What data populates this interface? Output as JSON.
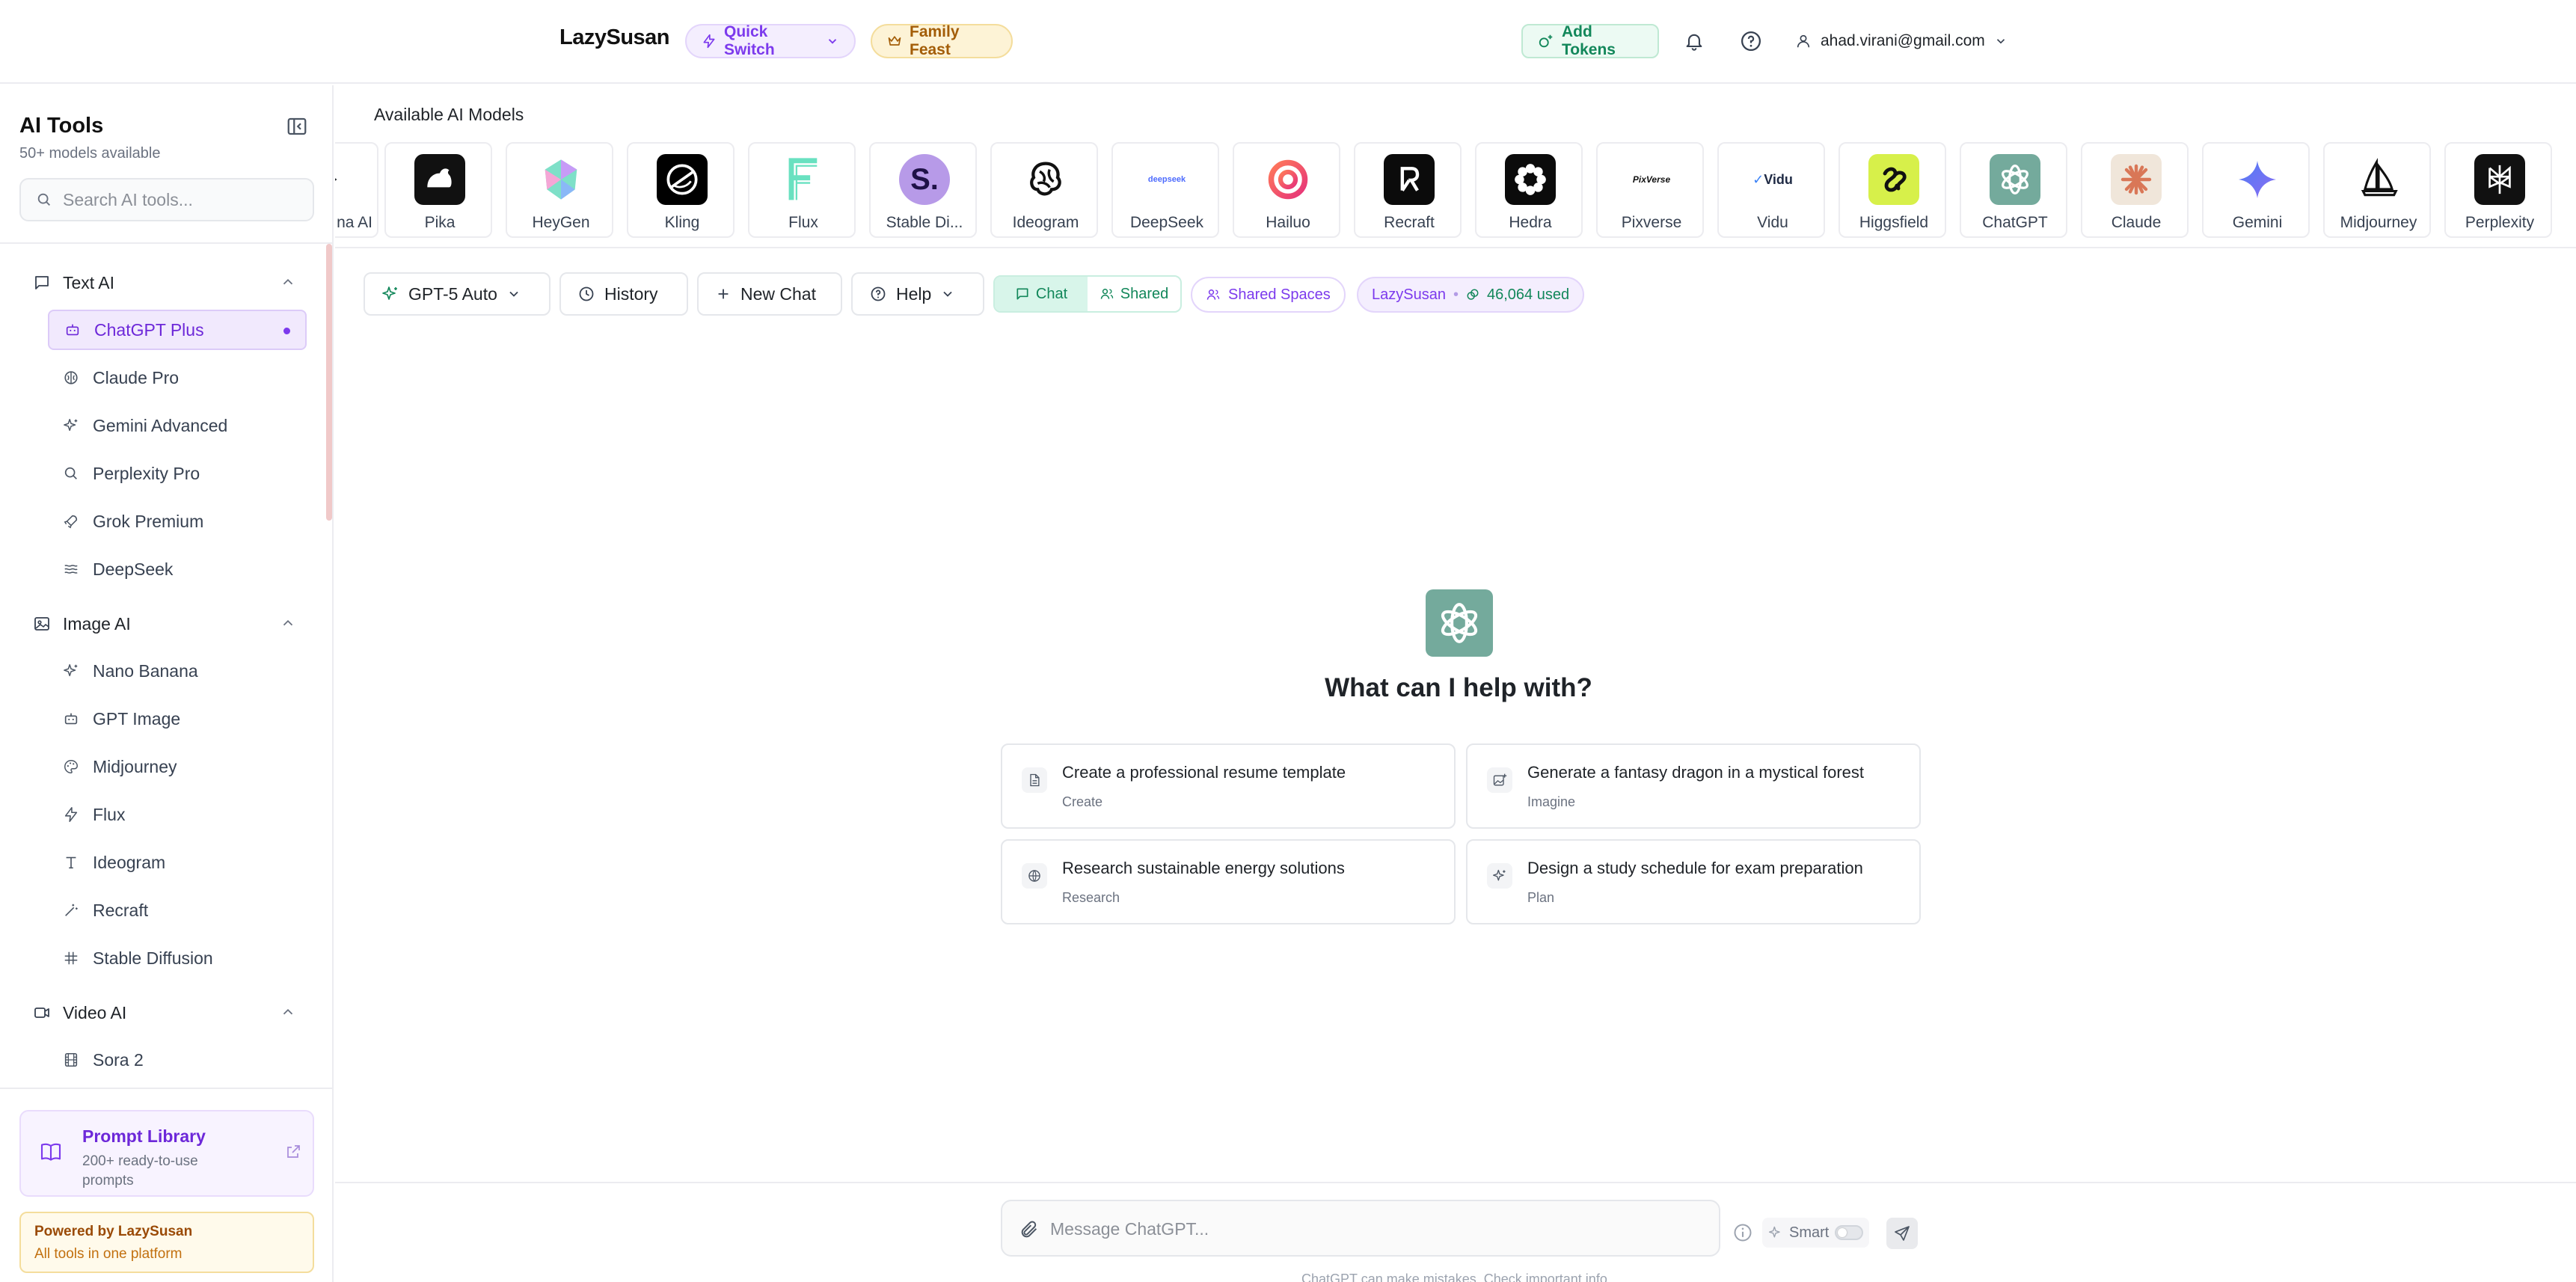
{
  "header": {
    "brand": "LazySusan",
    "quick_switch": "Quick Switch",
    "family_feast": "Family Feast",
    "add_tokens": "Add Tokens",
    "user_email": "ahad.virani@gmail.com"
  },
  "sidebar": {
    "title": "AI Tools",
    "subtitle": "50+ models available",
    "search_placeholder": "Search AI tools...",
    "sections": [
      {
        "label": "Text AI",
        "items": [
          "ChatGPT Plus",
          "Claude Pro",
          "Gemini Advanced",
          "Perplexity Pro",
          "Grok Premium",
          "DeepSeek"
        ]
      },
      {
        "label": "Image AI",
        "items": [
          "Nano Banana",
          "GPT Image",
          "Midjourney",
          "Flux",
          "Ideogram",
          "Recraft",
          "Stable Diffusion"
        ]
      },
      {
        "label": "Video AI",
        "items": [
          "Sora 2"
        ]
      }
    ],
    "active_item": "ChatGPT Plus",
    "prompt_library": {
      "title": "Prompt Library",
      "subtitle": "200+ ready-to-use prompts"
    },
    "powered": {
      "title": "Powered by LazySusan",
      "subtitle": "All tools in one platform"
    }
  },
  "models": {
    "label": "Available AI Models",
    "items": [
      "na AI",
      "Pika",
      "HeyGen",
      "Kling",
      "Flux",
      "Stable Di...",
      "Ideogram",
      "DeepSeek",
      "Hailuo",
      "Recraft",
      "Hedra",
      "Pixverse",
      "Vidu",
      "Higgsfield",
      "ChatGPT",
      "Claude",
      "Gemini",
      "Midjourney",
      "Perplexity"
    ],
    "logo_text": {
      "stable": "S.",
      "pixverse": "PixVerse",
      "vidu": "Vidu",
      "deepseek": "deepseek"
    }
  },
  "toolbar": {
    "model": "GPT-5 Auto",
    "history": "History",
    "new_chat": "New Chat",
    "help": "Help",
    "chat": "Chat",
    "shared": "Shared",
    "shared_spaces": "Shared Spaces",
    "brand": "LazySusan",
    "separator": "•",
    "usage": "46,064 used"
  },
  "welcome": {
    "title": "What can I help with?",
    "suggestions": [
      {
        "title": "Create a professional resume template",
        "category": "Create"
      },
      {
        "title": "Generate a fantasy dragon in a mystical forest",
        "category": "Imagine"
      },
      {
        "title": "Research sustainable energy solutions",
        "category": "Research"
      },
      {
        "title": "Design a study schedule for exam preparation",
        "category": "Plan"
      }
    ]
  },
  "composer": {
    "placeholder": "Message ChatGPT...",
    "smart": "Smart",
    "disclaimer": "ChatGPT can make mistakes. Check important info."
  },
  "colors": {
    "accent": "#7c3aed",
    "green": "#12875a",
    "chatgpt": "#74aa9c"
  }
}
